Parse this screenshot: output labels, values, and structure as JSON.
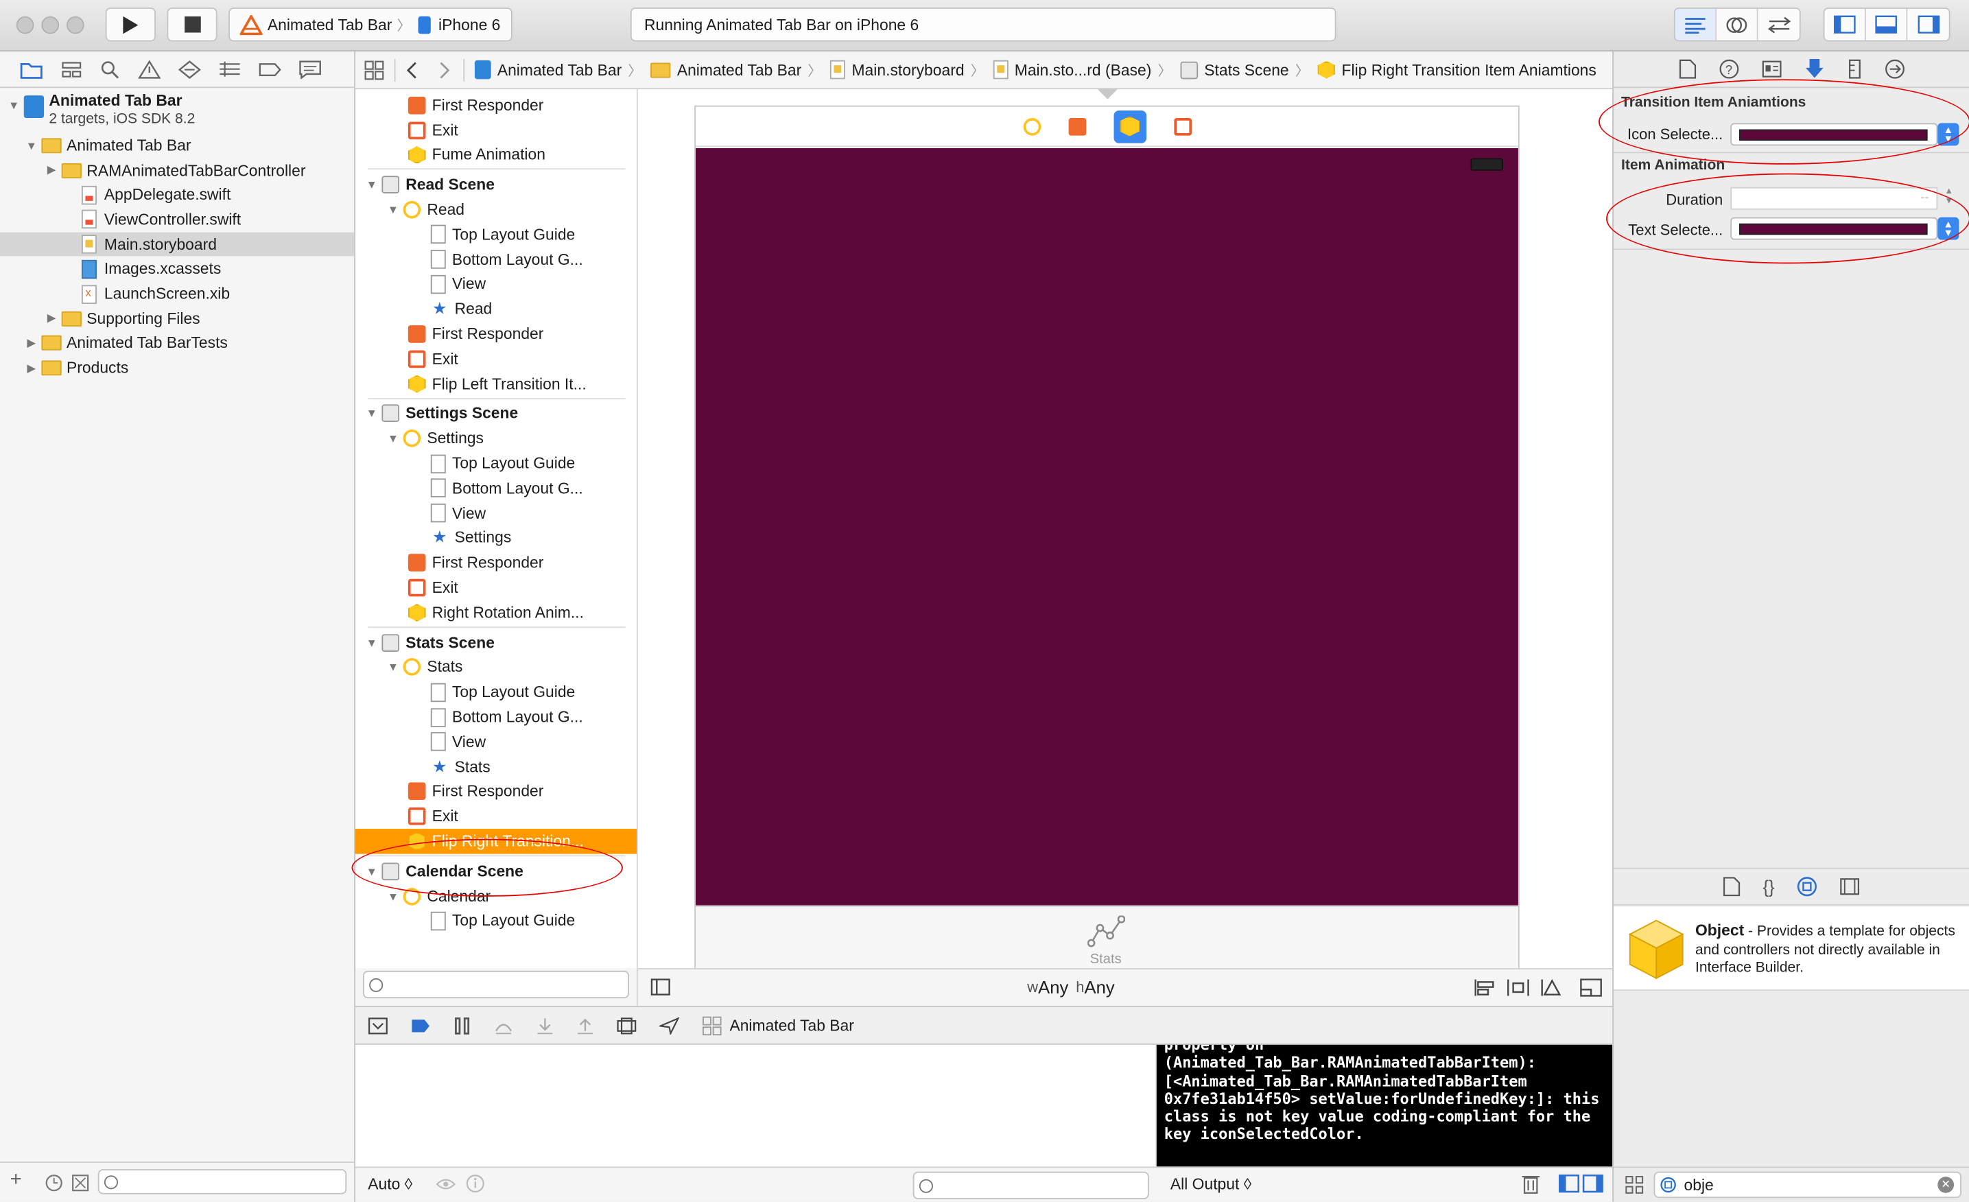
{
  "toolbar": {
    "scheme": "Animated Tab Bar",
    "destination": "iPhone 6",
    "activity": "Running Animated Tab Bar on iPhone 6"
  },
  "navigator": {
    "project_name": "Animated Tab Bar",
    "project_sub": "2 targets, iOS SDK 8.2",
    "items": [
      {
        "label": "Animated Tab Bar",
        "kind": "folder",
        "level": 1,
        "open": true
      },
      {
        "label": "RAMAnimatedTabBarController",
        "kind": "folder",
        "level": 2,
        "open": false
      },
      {
        "label": "AppDelegate.swift",
        "kind": "swift",
        "level": 3
      },
      {
        "label": "ViewController.swift",
        "kind": "swift",
        "level": 3
      },
      {
        "label": "Main.storyboard",
        "kind": "storyboard",
        "level": 3,
        "selected": true
      },
      {
        "label": "Images.xcassets",
        "kind": "assets",
        "level": 3
      },
      {
        "label": "LaunchScreen.xib",
        "kind": "xib",
        "level": 3
      },
      {
        "label": "Supporting Files",
        "kind": "folder",
        "level": 2,
        "open": false
      },
      {
        "label": "Animated Tab BarTests",
        "kind": "folder",
        "level": 1,
        "open": false
      },
      {
        "label": "Products",
        "kind": "folder",
        "level": 1,
        "open": false
      }
    ]
  },
  "jumpbar": {
    "crumbs": [
      "Animated Tab Bar",
      "Animated Tab Bar",
      "Main.storyboard",
      "Main.sto...rd (Base)",
      "Stats Scene",
      "Flip Right Transition Item Aniamtions"
    ]
  },
  "outline": {
    "items": [
      {
        "label": "First Responder",
        "icon": "fr",
        "level": 2
      },
      {
        "label": "Exit",
        "icon": "exit",
        "level": 2
      },
      {
        "label": "Fume Animation",
        "icon": "obj",
        "level": 2
      },
      {
        "label": "Read Scene",
        "icon": "scene",
        "level": 0,
        "bold": true
      },
      {
        "label": "Read",
        "icon": "vc",
        "level": 1
      },
      {
        "label": "Top Layout Guide",
        "icon": "guide",
        "level": 3
      },
      {
        "label": "Bottom Layout G...",
        "icon": "guide",
        "level": 3
      },
      {
        "label": "View",
        "icon": "guide",
        "level": 3
      },
      {
        "label": "Read",
        "icon": "tab",
        "level": 3
      },
      {
        "label": "First Responder",
        "icon": "fr",
        "level": 2
      },
      {
        "label": "Exit",
        "icon": "exit",
        "level": 2
      },
      {
        "label": "Flip Left Transition It...",
        "icon": "obj",
        "level": 2
      },
      {
        "label": "Settings Scene",
        "icon": "scene",
        "level": 0,
        "bold": true
      },
      {
        "label": "Settings",
        "icon": "vc",
        "level": 1
      },
      {
        "label": "Top Layout Guide",
        "icon": "guide",
        "level": 3
      },
      {
        "label": "Bottom Layout G...",
        "icon": "guide",
        "level": 3
      },
      {
        "label": "View",
        "icon": "guide",
        "level": 3
      },
      {
        "label": "Settings",
        "icon": "tab",
        "level": 3
      },
      {
        "label": "First Responder",
        "icon": "fr",
        "level": 2
      },
      {
        "label": "Exit",
        "icon": "exit",
        "level": 2
      },
      {
        "label": "Right Rotation Anim...",
        "icon": "obj",
        "level": 2
      },
      {
        "label": "Stats Scene",
        "icon": "scene",
        "level": 0,
        "bold": true
      },
      {
        "label": "Stats",
        "icon": "vc",
        "level": 1
      },
      {
        "label": "Top Layout Guide",
        "icon": "guide",
        "level": 3
      },
      {
        "label": "Bottom Layout G...",
        "icon": "guide",
        "level": 3
      },
      {
        "label": "View",
        "icon": "guide",
        "level": 3
      },
      {
        "label": "Stats",
        "icon": "tab",
        "level": 3
      },
      {
        "label": "First Responder",
        "icon": "fr",
        "level": 2
      },
      {
        "label": "Exit",
        "icon": "exit",
        "level": 2
      },
      {
        "label": "Flip Right Transition...",
        "icon": "obj",
        "level": 2,
        "selected": true
      },
      {
        "label": "Calendar Scene",
        "icon": "scene",
        "level": 0,
        "bold": true
      },
      {
        "label": "Calendar",
        "icon": "vc",
        "level": 1
      },
      {
        "label": "Top Layout Guide",
        "icon": "guide",
        "level": 3
      }
    ]
  },
  "canvas": {
    "view_color": "#5c0839",
    "tab_label": "Stats",
    "size_class_w": "Any",
    "size_class_h": "Any",
    "size_w_prefix": "w",
    "size_h_prefix": "h"
  },
  "debug": {
    "target": "Animated Tab Bar",
    "console_lines": [
      "property on",
      "(Animated_Tab_Bar.RAMAnimatedTabBarItem):",
      "[<Animated_Tab_Bar.RAMAnimatedTabBarItem",
      "0x7fe31ab14f50> setValue:forUndefinedKey:]: this",
      "class is not key value coding-compliant for the",
      "key iconSelectedColor."
    ],
    "auto_label": "Auto ◊",
    "output_label": "All Output ◊"
  },
  "inspector": {
    "section1_title": "Transition Item Aniamtions",
    "icon_selected_label": "Icon Selecte...",
    "section2_title": "Item Animation",
    "duration_label": "Duration",
    "duration_placeholder": "--",
    "text_selected_label": "Text Selecte...",
    "swatch_color": "#5c0839"
  },
  "library": {
    "item_title": "Object",
    "item_desc": " - Provides a template for objects and controllers not directly available in Interface Builder.",
    "search_value": "obje"
  }
}
